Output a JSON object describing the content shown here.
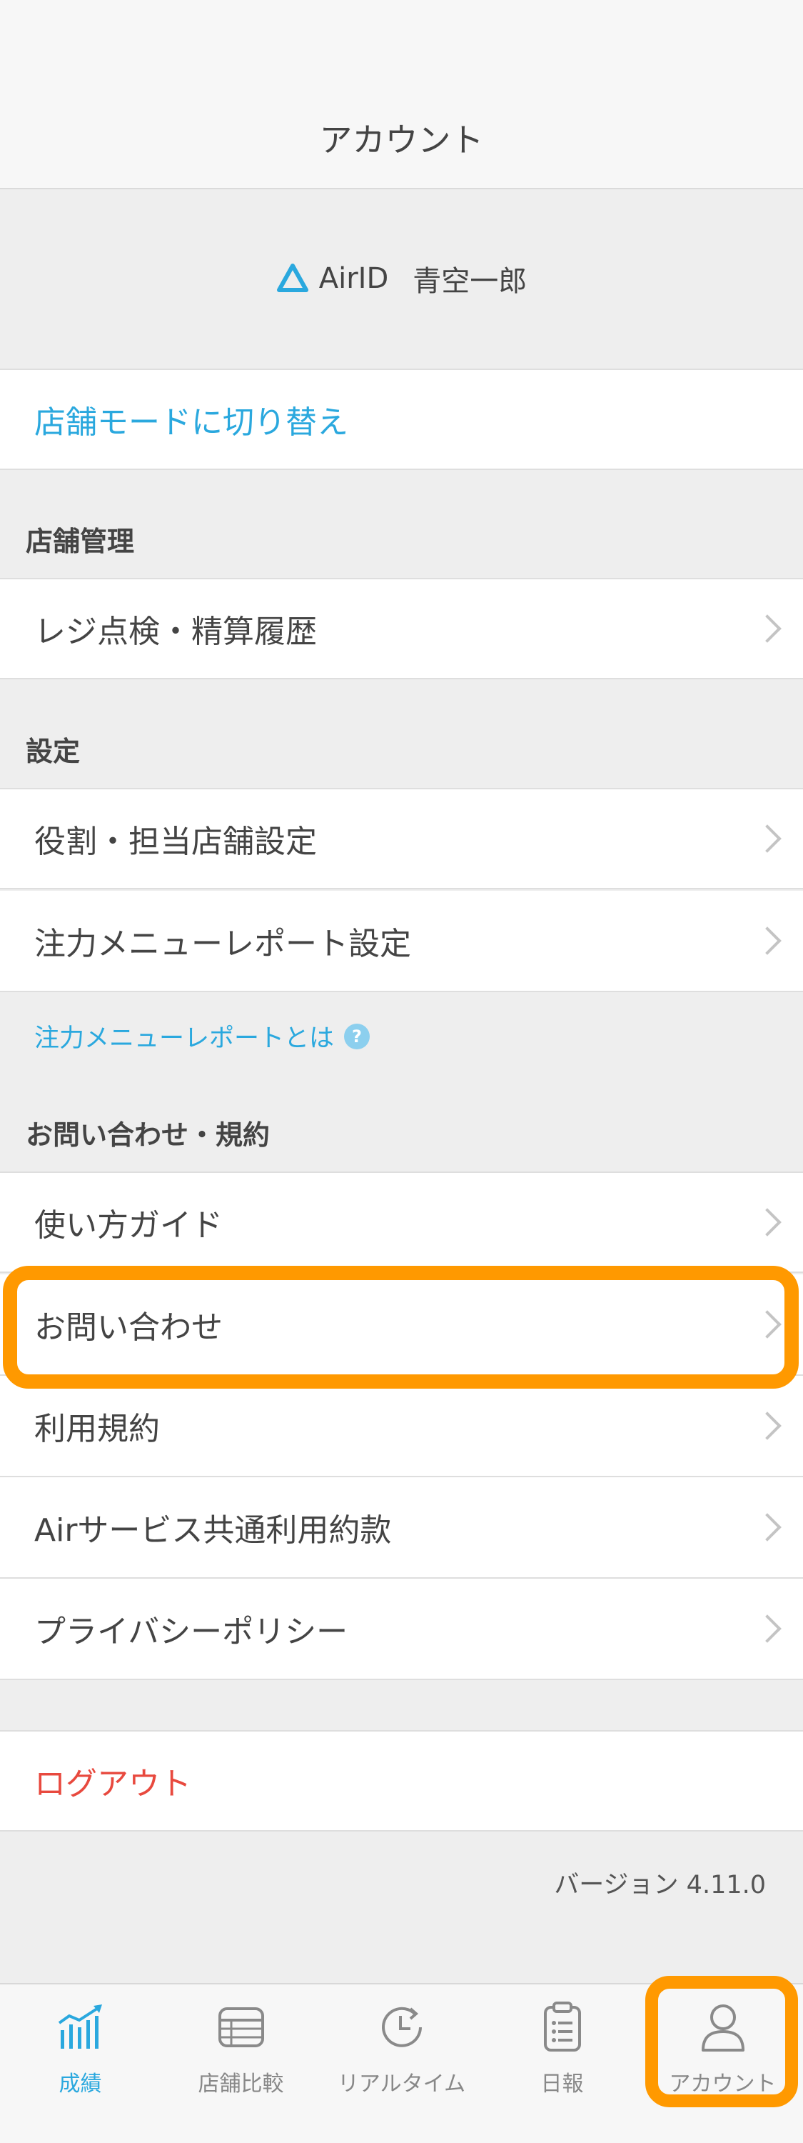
{
  "header": {
    "title": "アカウント"
  },
  "account": {
    "brand": "AirID",
    "user_name": "青空一郎"
  },
  "store_mode": {
    "label": "店舗モードに切り替え"
  },
  "sections": {
    "store_management": {
      "title": "店舗管理",
      "items": [
        "レジ点検・精算履歴"
      ]
    },
    "settings": {
      "title": "設定",
      "items": [
        "役割・担当店舗設定",
        "注力メニューレポート設定"
      ]
    },
    "settings_help": "注力メニューレポートとは",
    "support": {
      "title": "お問い合わせ・規約",
      "items": [
        "使い方ガイド",
        "お問い合わせ",
        "利用規約",
        "Airサービス共通利用約款",
        "プライバシーポリシー"
      ]
    }
  },
  "logout": {
    "label": "ログアウト"
  },
  "version": "バージョン 4.11.0",
  "tabbar": {
    "tabs": [
      {
        "label": "成績",
        "icon": "chart-trend-icon",
        "active": true
      },
      {
        "label": "店舗比較",
        "icon": "table-list-icon",
        "active": false
      },
      {
        "label": "リアルタイム",
        "icon": "clock-refresh-icon",
        "active": false
      },
      {
        "label": "日報",
        "icon": "clipboard-list-icon",
        "active": false
      },
      {
        "label": "アカウント",
        "icon": "person-icon",
        "active": false
      }
    ]
  },
  "colors": {
    "accent": "#2aa8de",
    "danger": "#e8493e",
    "highlight": "#ff9900"
  }
}
